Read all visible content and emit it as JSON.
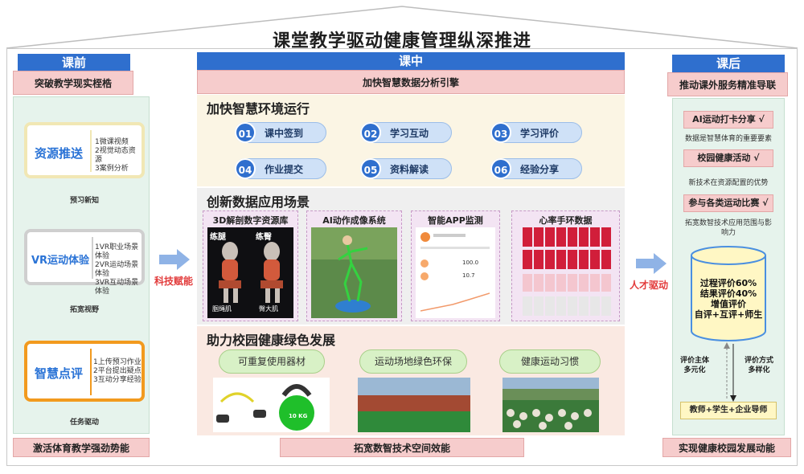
{
  "title": "课堂教学驱动健康管理纵深推进",
  "left": {
    "header": "课前",
    "subtitle": "突破教学现实桎梏",
    "footer": "激活体育教学强劲势能",
    "books": [
      {
        "title": "资源推送",
        "lines": [
          "1微课视频",
          "2视觉动态资源",
          "3案例分析"
        ],
        "caption": "预习新知",
        "color": "#f1e7b4"
      },
      {
        "title": "VR运动体验",
        "lines": [
          "1VR职业场景体验",
          "2VR运动场景体验",
          "3VR互动场景体验"
        ],
        "caption": "拓宽视野",
        "color": "#cfcfcf"
      },
      {
        "title": "智慧点评",
        "lines": [
          "1上传预习作业",
          "2平台提出疑点",
          "3互动分享经验"
        ],
        "caption": "任务驱动",
        "color": "#f29a1e"
      }
    ]
  },
  "middle": {
    "header": "课中",
    "subtitle": "加快智慧数据分析引擎",
    "footer": "拓宽数智技术空间效能",
    "section1": {
      "title": "加快智慧环境运行",
      "items": [
        {
          "num": "01",
          "label": "课中签到"
        },
        {
          "num": "02",
          "label": "学习互动"
        },
        {
          "num": "03",
          "label": "学习评价"
        },
        {
          "num": "04",
          "label": "作业提交"
        },
        {
          "num": "05",
          "label": "资料解读"
        },
        {
          "num": "06",
          "label": "经验分享"
        }
      ]
    },
    "section2": {
      "title": "创新数据应用场景",
      "cards": [
        "3D解剖数字资源库",
        "AI动作成像系统",
        "智能APP监测",
        "心率手环数据"
      ],
      "anatomy_labels": [
        "练腿",
        "练臀",
        "腘绳肌",
        "臀大肌"
      ],
      "app_values": [
        "100.0",
        "10.7"
      ]
    },
    "section3": {
      "title": "助力校园健康绿色发展",
      "items": [
        "可重复使用器材",
        "运动场地绿色环保",
        "健康运动习惯"
      ],
      "kettlebell_label": "10 KG"
    }
  },
  "arrows": {
    "left": "科技赋能",
    "right": "人才驱动"
  },
  "right": {
    "header": "课后",
    "subtitle": "推动课外服务精准导联",
    "footer": "实现健康校园发展动能",
    "items": [
      {
        "label": "AI运动打卡分享 √",
        "text": "数据是智慧体育的重要要素"
      },
      {
        "label": "校园健康活动 √",
        "text": "新技术在资源配置的优势"
      },
      {
        "label": "参与各类运动比赛 √",
        "text": "拓宽数智技术应用范围与影响力"
      }
    ],
    "cylinder_lines": [
      "过程评价60%",
      "结果评价40%",
      "增值评价",
      "自评+互评+师生"
    ],
    "side_left": [
      "评价主体",
      "多元化"
    ],
    "side_right": [
      "评价方式",
      "多样化"
    ],
    "bottom_box": "教师+学生+企业导师"
  }
}
